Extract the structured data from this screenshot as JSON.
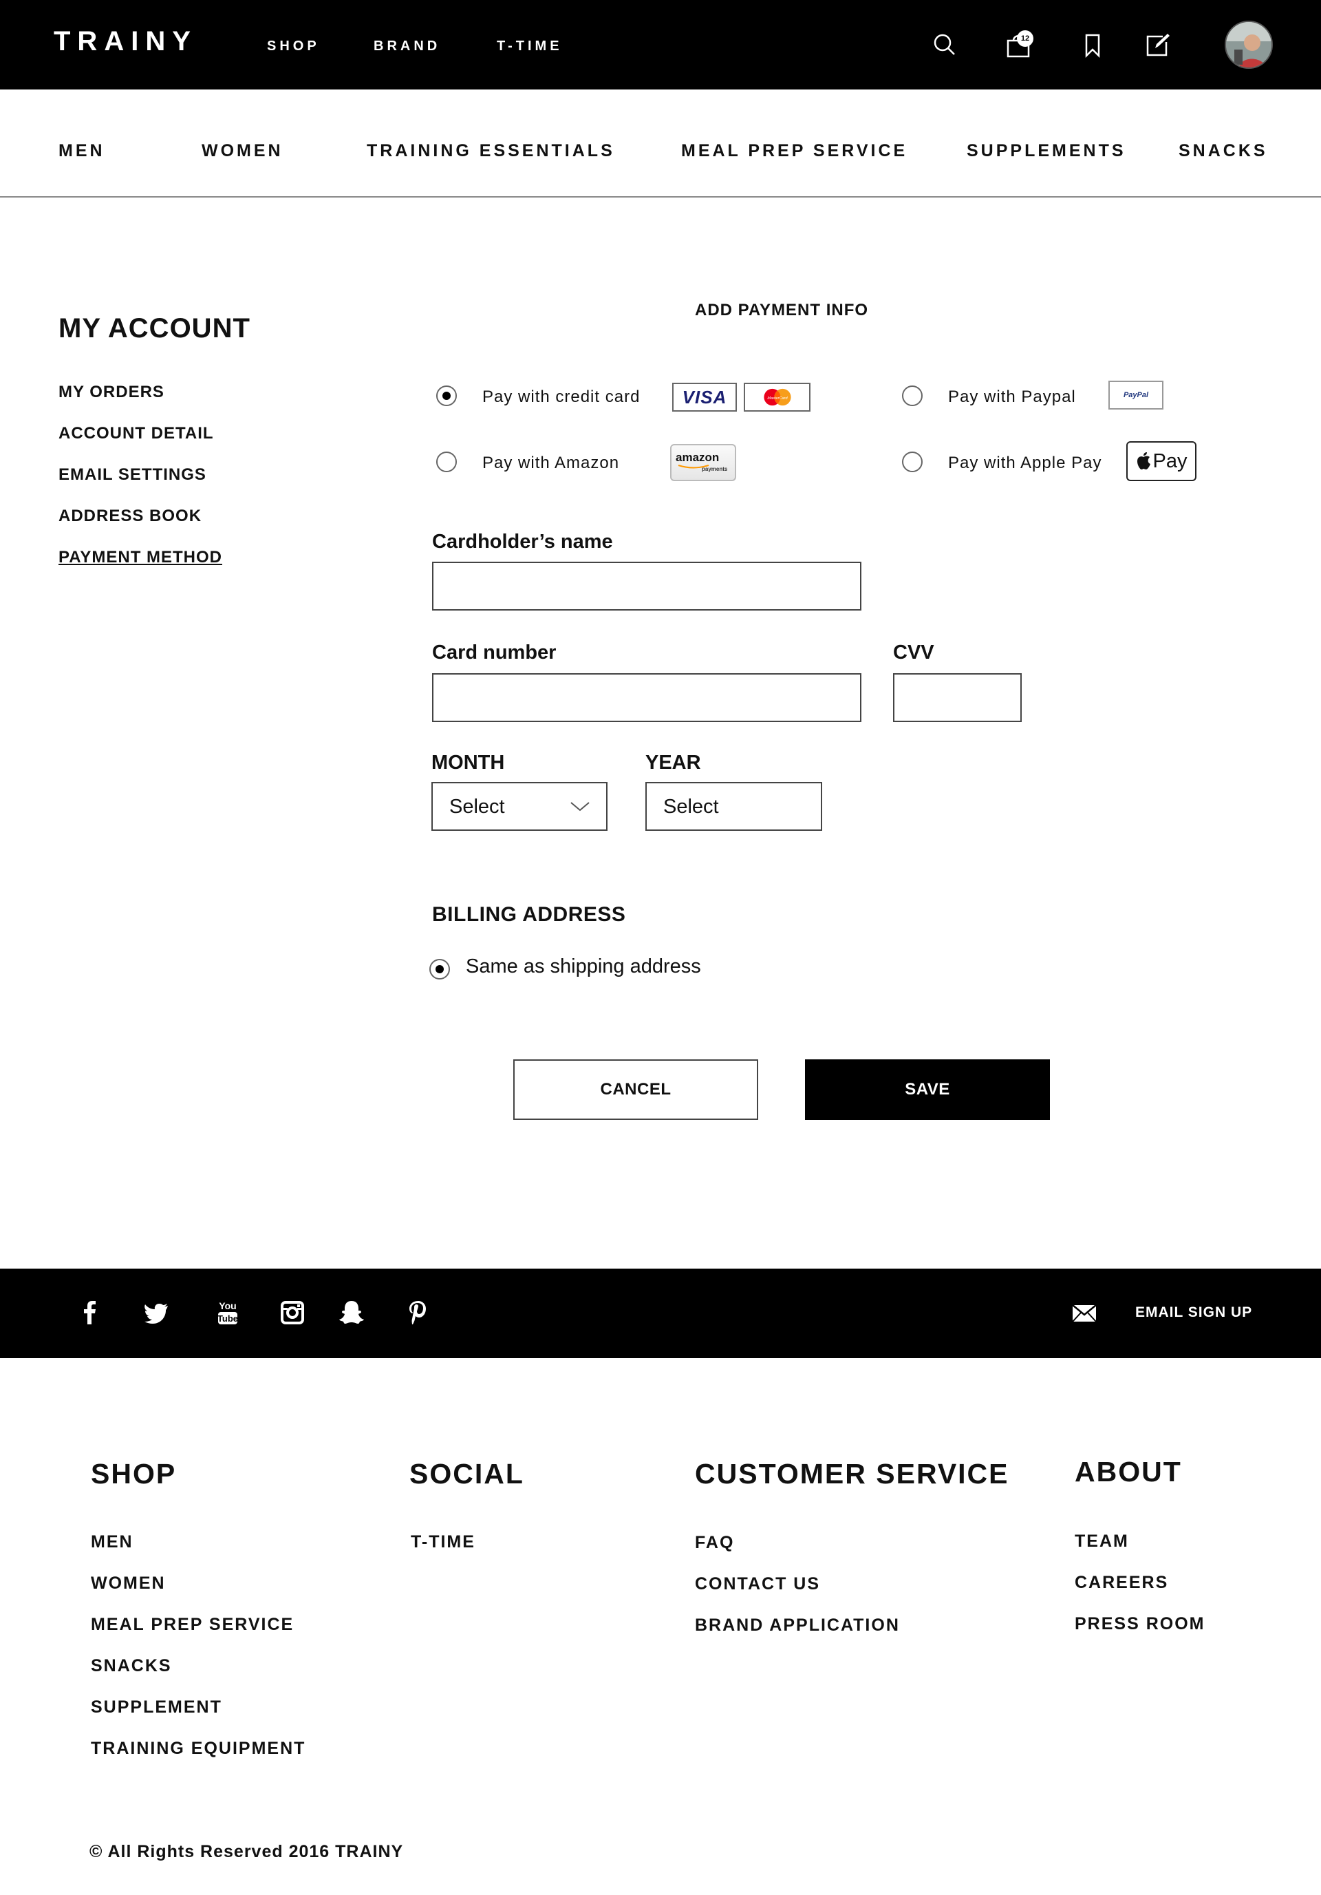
{
  "header": {
    "logo": "TRAINY",
    "nav": [
      "SHOP",
      "BRAND",
      "T-TIME"
    ],
    "cart_count": "12",
    "icons": [
      "search-icon",
      "shopping-bag-icon",
      "bookmark-icon",
      "edit-icon"
    ]
  },
  "categories": [
    "MEN",
    "WOMEN",
    "TRAINING ESSENTIALS",
    "MEAL PREP SERVICE",
    "SUPPLEMENTS",
    "SNACKS"
  ],
  "sidebar": {
    "title": "MY ACCOUNT",
    "items": [
      "MY ORDERS",
      "ACCOUNT DETAIL",
      "EMAIL SETTINGS",
      "ADDRESS BOOK",
      "PAYMENT METHOD"
    ],
    "active": "PAYMENT METHOD"
  },
  "form": {
    "title": "ADD PAYMENT INFO",
    "options": {
      "credit_card": "Pay with credit card",
      "paypal": "Pay with Paypal",
      "amazon": "Pay with Amazon",
      "applepay": "Pay with Apple Pay"
    },
    "selected_option": "credit_card",
    "logos": {
      "visa": "VISA",
      "mastercard": "MasterCard",
      "paypal": "PayPal",
      "amazon": "amazon",
      "amazon_sub": "payments",
      "applepay": "Pay"
    },
    "cardholder_label": "Cardholder’s name",
    "cardholder_value": "",
    "card_number_label": "Card number",
    "card_number_value": "",
    "cvv_label": "CVV",
    "cvv_value": "",
    "month_label": "MONTH",
    "month_value": "Select",
    "year_label": "YEAR",
    "year_value": "Select",
    "billing_title": "BILLING ADDRESS",
    "billing_same": "Same as shipping address",
    "billing_same_checked": true,
    "cancel": "CANCEL",
    "save": "SAVE"
  },
  "footer_bar": {
    "social_icons": [
      "facebook-icon",
      "twitter-icon",
      "youtube-icon",
      "instagram-icon",
      "snapchat-icon",
      "pinterest-icon"
    ],
    "youtube_you": "You",
    "youtube_tube": "Tube",
    "email_signup": "EMAIL SIGN UP"
  },
  "footer": {
    "shop": {
      "title": "SHOP",
      "links": [
        "MEN",
        "WOMEN",
        "MEAL PREP SERVICE",
        "SNACKS",
        "SUPPLEMENT",
        "TRAINING EQUIPMENT"
      ]
    },
    "social": {
      "title": "SOCIAL",
      "links": [
        "T-TIME"
      ]
    },
    "customer_service": {
      "title": "CUSTOMER SERVICE",
      "links": [
        "FAQ",
        "CONTACT US",
        "BRAND APPLICATION"
      ]
    },
    "about": {
      "title": "ABOUT",
      "links": [
        "TEAM",
        "CAREERS",
        "PRESS ROOM"
      ]
    },
    "copyright": "© All Rights Reserved 2016 TRAINY"
  },
  "colors": {
    "bar": "#000000",
    "text": "#111111",
    "border": "#444444"
  }
}
